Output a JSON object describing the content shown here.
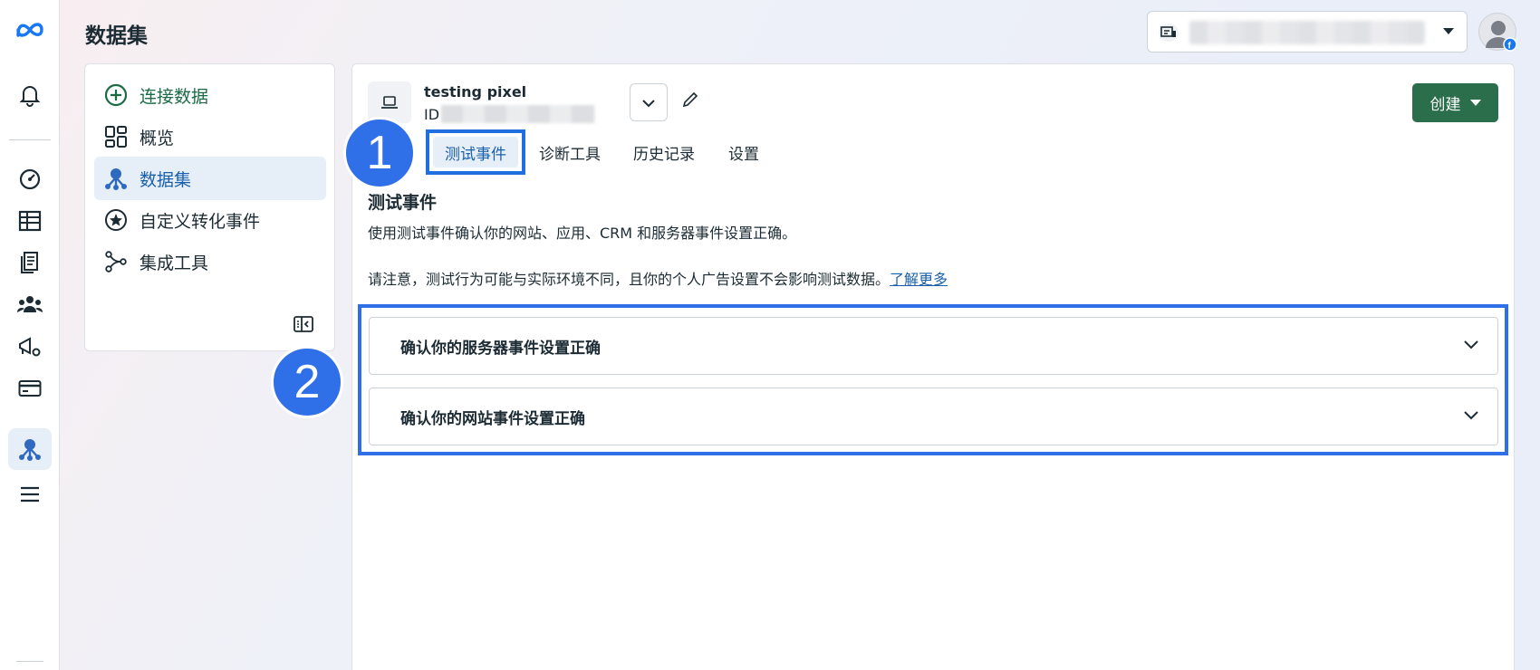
{
  "header": {
    "title": "数据集"
  },
  "rail": {
    "icons": [
      "meta-logo-icon",
      "bell-icon",
      "dashboard-icon",
      "table-icon",
      "documents-icon",
      "people-icon",
      "megaphone-gear-icon",
      "card-icon",
      "dataset-icon",
      "menu-icon"
    ],
    "active": "dataset-icon"
  },
  "nav": {
    "items": [
      {
        "label": "连接数据",
        "icon": "plus-circle-icon"
      },
      {
        "label": "概览",
        "icon": "grid-icon"
      },
      {
        "label": "数据集",
        "icon": "dataset-icon"
      },
      {
        "label": "自定义转化事件",
        "icon": "star-circle-icon"
      },
      {
        "label": "集成工具",
        "icon": "integration-icon"
      }
    ],
    "active_index": 2
  },
  "dataset": {
    "name": "testing pixel",
    "id_label": "ID"
  },
  "toolbar": {
    "create_label": "创建"
  },
  "tabs": [
    {
      "label": "测试事件"
    },
    {
      "label": "诊断工具"
    },
    {
      "label": "历史记录"
    },
    {
      "label": "设置"
    }
  ],
  "section": {
    "title": "测试事件",
    "description": "使用测试事件确认你的网站、应用、CRM 和服务器事件设置正确。",
    "note": "请注意，测试行为可能与实际环境不同，且你的个人广告设置不会影响测试数据。",
    "learn_more": "了解更多"
  },
  "accordions": [
    {
      "label": "确认你的服务器事件设置正确"
    },
    {
      "label": "确认你的网站事件设置正确"
    }
  ],
  "badges": {
    "one": "1",
    "two": "2"
  },
  "colors": {
    "accent": "#2f6fe8",
    "create": "#2b6e4c",
    "link": "#1a5fab"
  }
}
